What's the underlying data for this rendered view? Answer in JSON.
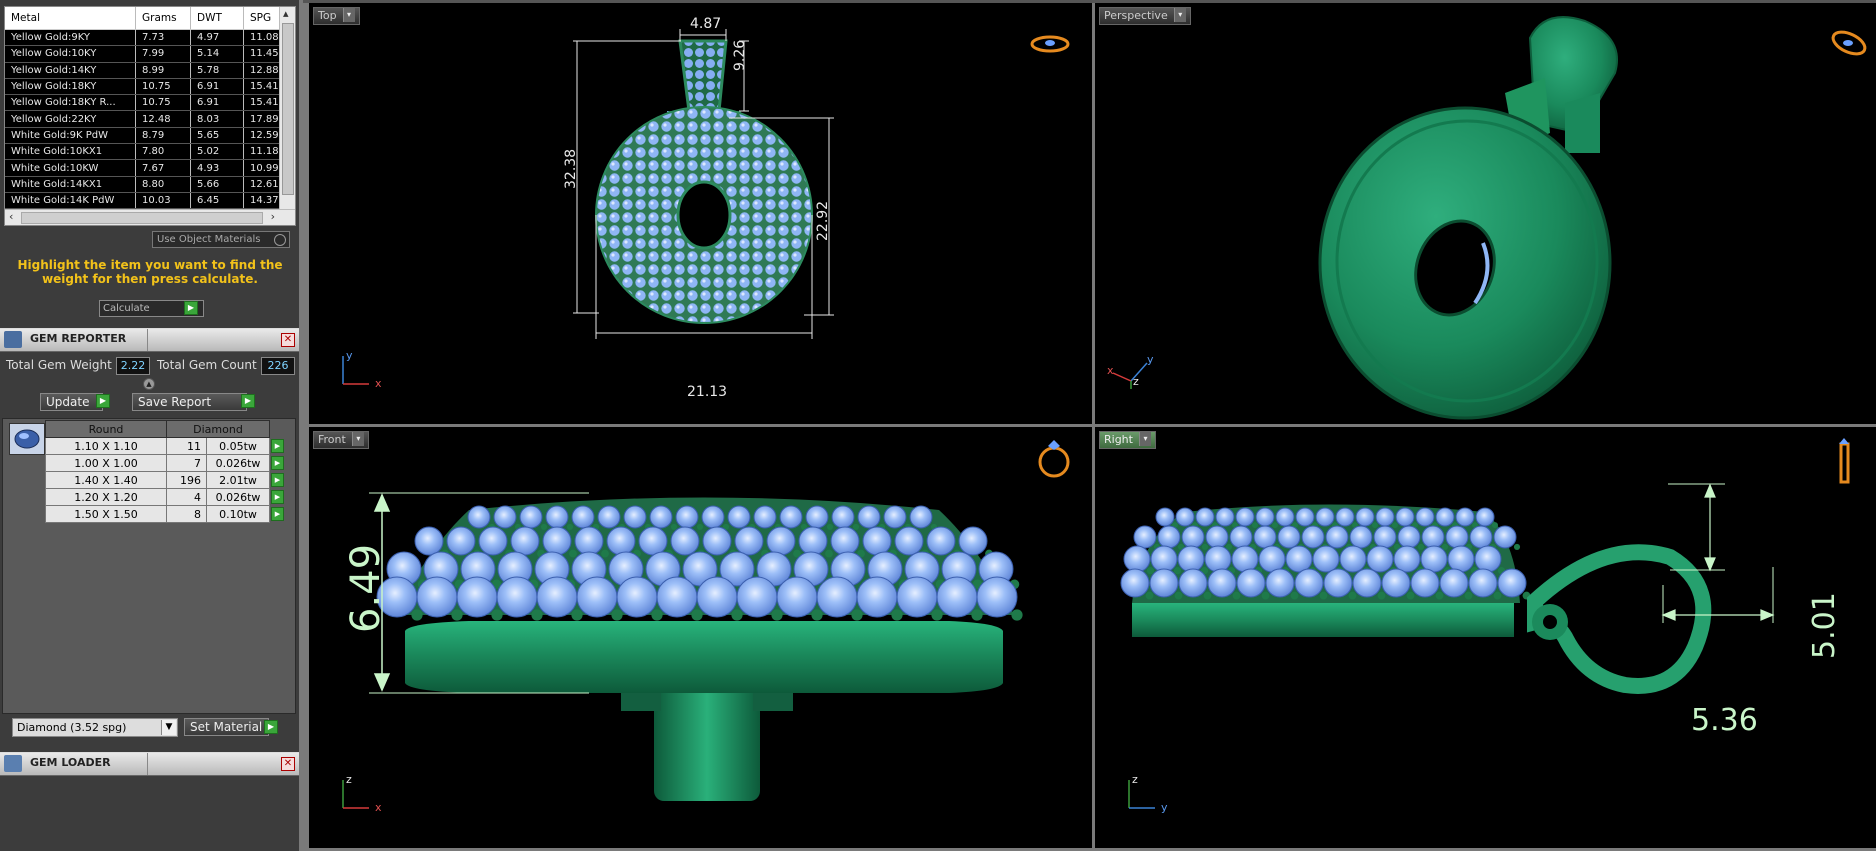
{
  "metal_table": {
    "headers": [
      "Metal",
      "Grams",
      "DWT",
      "SPG"
    ],
    "rows": [
      [
        "Yellow Gold:9KY",
        "7.73",
        "4.97",
        "11.08"
      ],
      [
        "Yellow Gold:10KY",
        "7.99",
        "5.14",
        "11.45"
      ],
      [
        "Yellow Gold:14KY",
        "8.99",
        "5.78",
        "12.88"
      ],
      [
        "Yellow Gold:18KY",
        "10.75",
        "6.91",
        "15.41"
      ],
      [
        "Yellow Gold:18KY R...",
        "10.75",
        "6.91",
        "15.41"
      ],
      [
        "Yellow Gold:22KY",
        "12.48",
        "8.03",
        "17.89"
      ],
      [
        "White Gold:9K PdW",
        "8.79",
        "5.65",
        "12.59"
      ],
      [
        "White Gold:10KX1",
        "7.80",
        "5.02",
        "11.18"
      ],
      [
        "White Gold:10KW",
        "7.67",
        "4.93",
        "10.99"
      ],
      [
        "White Gold:14KX1",
        "8.80",
        "5.66",
        "12.61"
      ],
      [
        "White Gold:14K PdW",
        "10.03",
        "6.45",
        "14.37"
      ]
    ]
  },
  "use_object_materials": "Use Object Materials",
  "hint": "Highlight the item you want to find the weight for then press calculate.",
  "calculate_label": "Calculate",
  "gem_reporter": {
    "title": "GEM REPORTER",
    "total_weight_label": "Total Gem Weight",
    "total_weight": "2.22",
    "total_count_label": "Total Gem Count",
    "total_count": "226",
    "update_label": "Update",
    "save_label": "Save Report",
    "columns": [
      "Round",
      "Diamond"
    ],
    "rows": [
      {
        "size": "1.10 X 1.10",
        "count": "11",
        "weight": "0.05tw"
      },
      {
        "size": "1.00 X 1.00",
        "count": "7",
        "weight": "0.026tw"
      },
      {
        "size": "1.40 X 1.40",
        "count": "196",
        "weight": "2.01tw"
      },
      {
        "size": "1.20 X 1.20",
        "count": "4",
        "weight": "0.026tw"
      },
      {
        "size": "1.50 X 1.50",
        "count": "8",
        "weight": "0.10tw"
      }
    ],
    "material_select": "Diamond    (3.52 spg)",
    "set_material_label": "Set Material"
  },
  "gem_loader": {
    "title": "GEM LOADER"
  },
  "viewports": {
    "top": {
      "label": "Top",
      "dims": [
        "4.87",
        "9.26",
        "32.38",
        "22.92",
        "21.13"
      ]
    },
    "perspective": {
      "label": "Perspective"
    },
    "front": {
      "label": "Front",
      "dims": [
        "6.49"
      ]
    },
    "right": {
      "label": "Right",
      "dims": [
        "5.01",
        "5.36"
      ]
    }
  },
  "axes": {
    "x": "x",
    "y": "y",
    "z": "z"
  },
  "colors": {
    "metal": "#1f9a6a",
    "gem": "#8fb6f5",
    "dimension": "#e8e8e8",
    "active_tab": "#4f8a4f"
  }
}
